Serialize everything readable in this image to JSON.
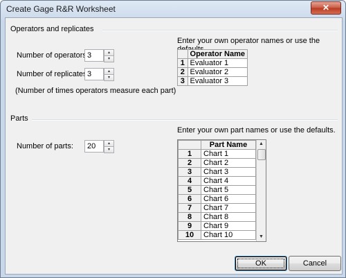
{
  "window": {
    "title": "Create Gage R&R Worksheet",
    "close_label": "✕"
  },
  "operators_section": {
    "label": "Operators and replicates",
    "instructions": "Enter your own operator names or use the defaults.",
    "num_operators_label": "Number of operators:",
    "num_operators_value": "3",
    "num_replicates_label": "Number of replicates:",
    "num_replicates_value": "3",
    "note": "(Number of times operators measure each part)",
    "table_header": "Operator Name",
    "rows": [
      {
        "num": "1",
        "name": "Evaluator 1"
      },
      {
        "num": "2",
        "name": "Evaluator 2"
      },
      {
        "num": "3",
        "name": "Evaluator 3"
      }
    ]
  },
  "parts_section": {
    "label": "Parts",
    "instructions": "Enter your own part names or use the defaults.",
    "num_parts_label": "Number of parts:",
    "num_parts_value": "20",
    "table_header": "Part Name",
    "rows": [
      {
        "num": "1",
        "name": "Chart 1"
      },
      {
        "num": "2",
        "name": "Chart 2"
      },
      {
        "num": "3",
        "name": "Chart 3"
      },
      {
        "num": "4",
        "name": "Chart 4"
      },
      {
        "num": "5",
        "name": "Chart 5"
      },
      {
        "num": "6",
        "name": "Chart 6"
      },
      {
        "num": "7",
        "name": "Chart 7"
      },
      {
        "num": "8",
        "name": "Chart 8"
      },
      {
        "num": "9",
        "name": "Chart 9"
      },
      {
        "num": "10",
        "name": "Chart 10"
      }
    ]
  },
  "buttons": {
    "ok": "OK",
    "cancel": "Cancel"
  },
  "icons": {
    "spin_up": "▴",
    "spin_down": "▾",
    "scroll_up": "▲",
    "scroll_down": "▼"
  }
}
